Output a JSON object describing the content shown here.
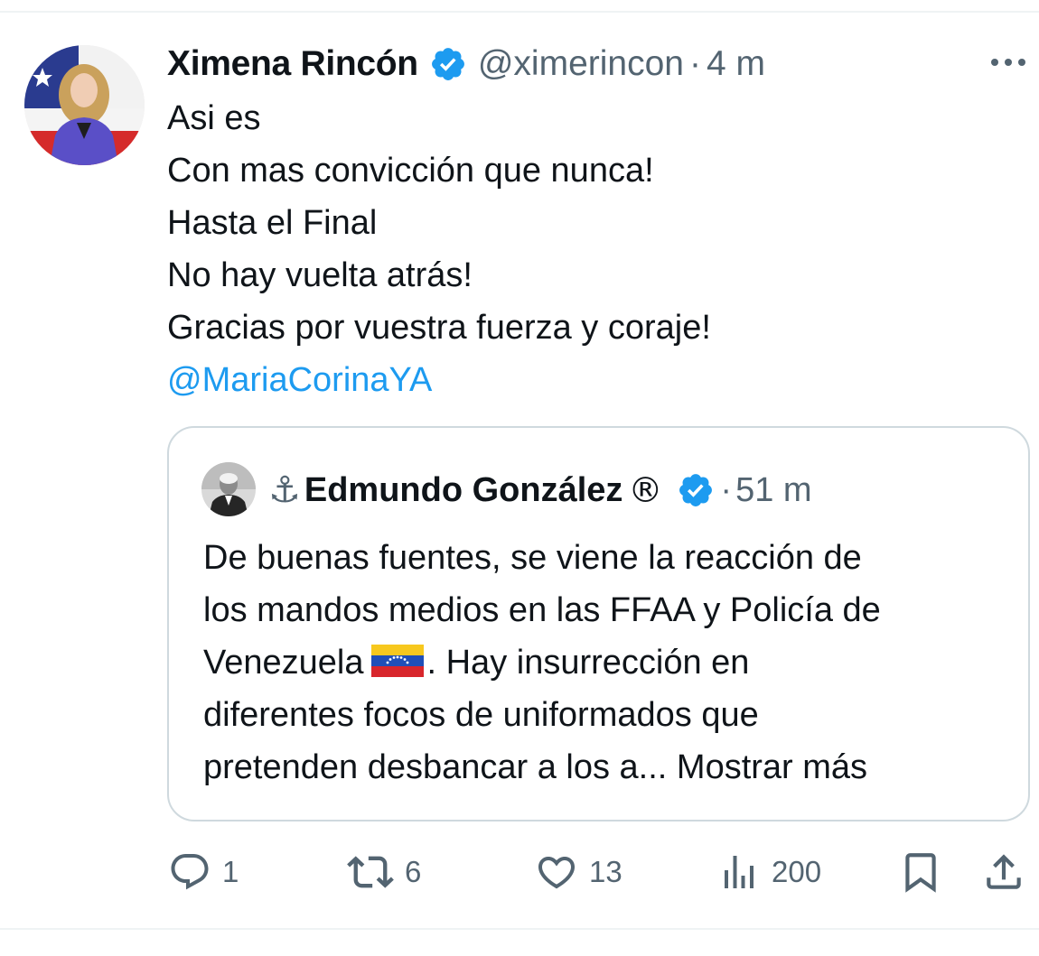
{
  "tweet": {
    "author": {
      "display_name": "Ximena Rincón",
      "handle": "@ximerincon",
      "verified": true,
      "avatar": "avatar"
    },
    "separator": "·",
    "time": "4 m",
    "more_icon": "more-icon",
    "text_lines": [
      "Asi es",
      "Con mas convicción que nunca!",
      "Hasta el Final",
      "No hay vuelta atrás!",
      "Gracias por vuestra fuerza y coraje!"
    ],
    "mention": "@MariaCorinaYA"
  },
  "quote": {
    "author": {
      "prefix_emoji": "⚓",
      "display_name": "Edmundo González",
      "registered_mark": "®",
      "verified": true,
      "avatar": "avatar"
    },
    "separator": "·",
    "time": "51 m",
    "text_lines": [
      "De buenas fuentes, se viene la reacción de",
      "los mandos medios en las FFAA y Policía de"
    ],
    "line3_before_flag": "Venezuela",
    "flag_icon": "venezuela-flag-icon",
    "line3_after_flag": ". Hay insurrección en",
    "text_lines_after": [
      "diferentes focos de uniformados que",
      "pretenden desbancar a los a... Mostrar más"
    ]
  },
  "actions": {
    "reply": {
      "icon": "reply-icon",
      "count": "1"
    },
    "retweet": {
      "icon": "retweet-icon",
      "count": "6"
    },
    "like": {
      "icon": "heart-icon",
      "count": "13"
    },
    "views": {
      "icon": "views-icon",
      "count": "200"
    },
    "bookmark": {
      "icon": "bookmark-icon"
    },
    "share": {
      "icon": "share-icon"
    }
  },
  "colors": {
    "text": "#0f1419",
    "secondary": "#536471",
    "link": "#1d9bf0",
    "verified": "#1d9bf0",
    "border": "#cfd9de"
  }
}
